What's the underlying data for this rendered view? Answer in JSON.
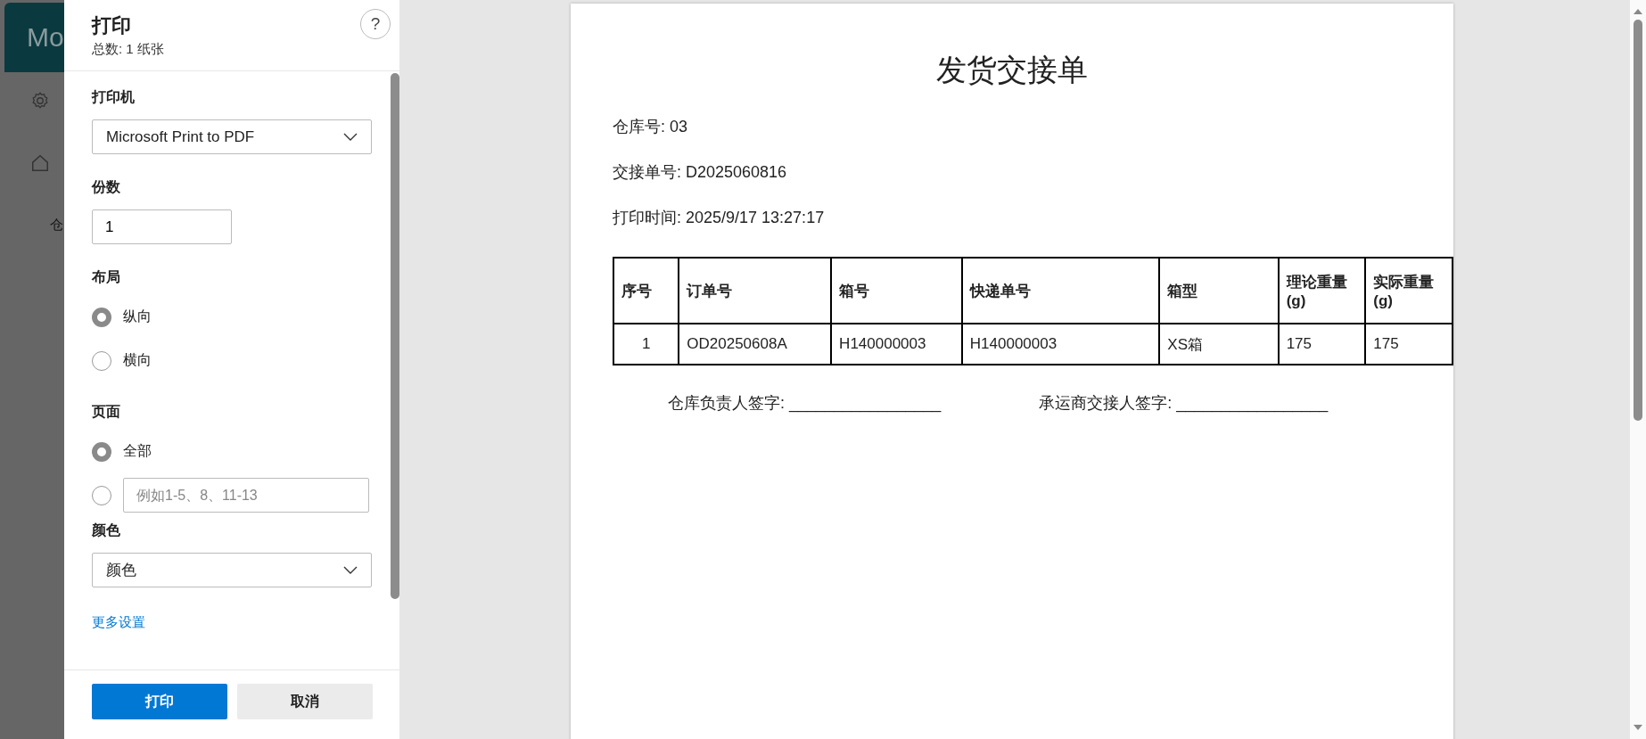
{
  "backdrop": {
    "app_title": "Mo",
    "partial_text": "仓"
  },
  "print_dialog": {
    "title": "打印",
    "help": "?",
    "total": "总数: 1 纸张",
    "printer": {
      "label": "打印机",
      "value": "Microsoft Print to PDF"
    },
    "copies": {
      "label": "份数",
      "value": "1"
    },
    "layout": {
      "label": "布局",
      "options": [
        {
          "label": "纵向",
          "selected": true
        },
        {
          "label": "横向",
          "selected": false
        }
      ]
    },
    "pages": {
      "label": "页面",
      "options": [
        {
          "kind": "text",
          "label": "全部",
          "selected": true
        },
        {
          "kind": "field",
          "placeholder": "例如1-5、8、11-13",
          "selected": false
        }
      ]
    },
    "color": {
      "label": "颜色",
      "value": "颜色"
    },
    "more_settings": "更多设置",
    "buttons": [
      {
        "label": "打印",
        "kind": "primary"
      },
      {
        "label": "取消",
        "kind": "secondary"
      }
    ]
  },
  "preview": {
    "title": "发货交接单",
    "fields": [
      "仓库号: 03",
      "交接单号: D2025060816",
      "打印时间: 2025/9/17 13:27:17"
    ],
    "table": {
      "columns": [
        "序号",
        "订单号",
        "箱号",
        "快递单号",
        "箱型",
        "理论重量(g)",
        "实际重量(g)"
      ],
      "rows": [
        [
          "1",
          "OD20250608A",
          "H140000003",
          "H140000003",
          "XS箱",
          "175",
          "175"
        ]
      ]
    },
    "signatures": [
      "仓库负责人签字: _________________",
      "承运商交接人签字: _________________"
    ]
  }
}
